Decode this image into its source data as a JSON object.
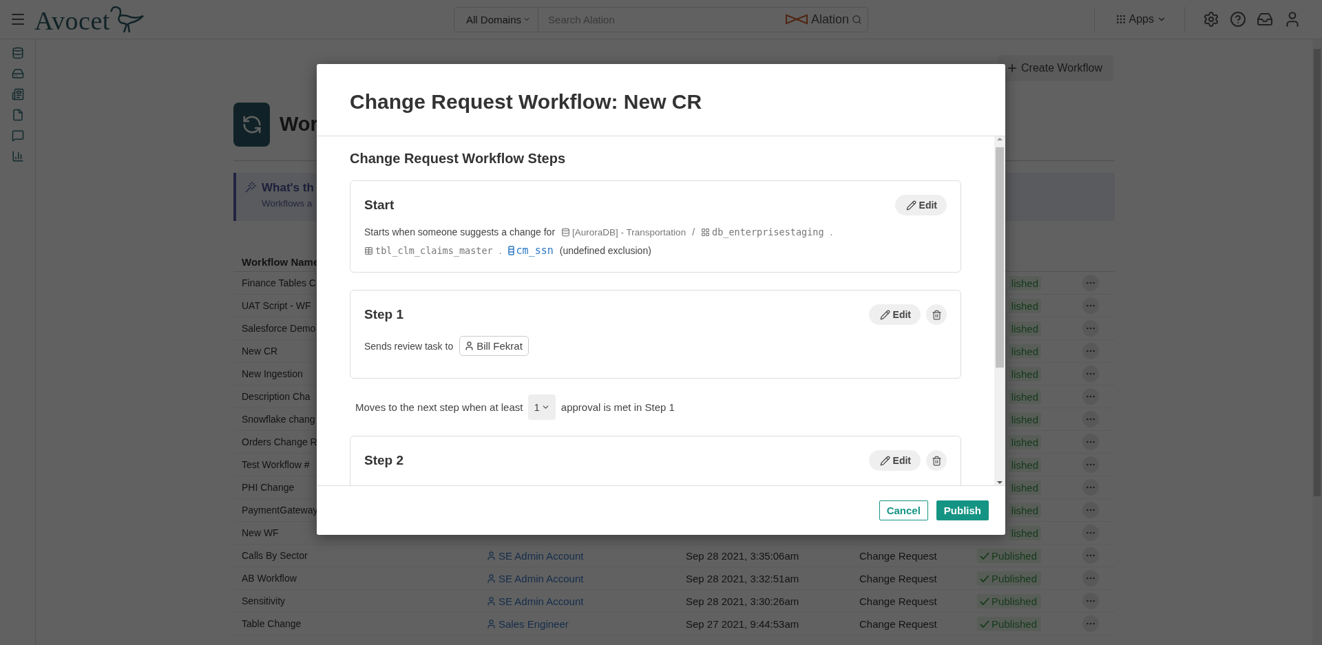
{
  "top_bar": {
    "logo": "Avocet",
    "domain_filter": "All Domains",
    "search": {
      "placeholder": "Search Alation"
    },
    "search_brand": "Alation",
    "apps": "Apps"
  },
  "page": {
    "title": "Wor",
    "create_button": "Create Workflow",
    "banner": {
      "title": "What's th",
      "text": "Workflows a"
    }
  },
  "table": {
    "columns": [
      "Workflow Name"
    ],
    "rows": [
      {
        "name": "Finance Tables C",
        "status": "lished",
        "checkmark": false
      },
      {
        "name": "UAT Script - WF",
        "status": "lished",
        "checkmark": false
      },
      {
        "name": "Salesforce Demo",
        "status": "lished",
        "checkmark": false
      },
      {
        "name": "New CR",
        "status": "lished",
        "checkmark": false
      },
      {
        "name": "New Ingestion",
        "status": "lished",
        "checkmark": false
      },
      {
        "name": "Description Cha",
        "status": "lished",
        "checkmark": false
      },
      {
        "name": "Snowflake chang",
        "status": "lished",
        "checkmark": false
      },
      {
        "name": "Orders Change R",
        "status": "lished",
        "checkmark": false
      },
      {
        "name": "Test Workflow #",
        "status": "lished",
        "checkmark": false
      },
      {
        "name": "PHI Change",
        "status": "lished",
        "checkmark": false
      },
      {
        "name": "PaymentGateway",
        "status": "lished",
        "checkmark": false
      },
      {
        "name": "New WF",
        "status": "lished",
        "checkmark": false
      },
      {
        "name": "Calls By Sector",
        "owner": "SE Admin Account",
        "date": "Sep 28 2021, 3:35:06am",
        "type": "Change Request",
        "status": "Published",
        "checkmark": true
      },
      {
        "name": "AB Workflow",
        "owner": "SE Admin Account",
        "date": "Sep 28 2021, 3:32:51am",
        "type": "Change Request",
        "status": "Published",
        "checkmark": true
      },
      {
        "name": "Sensitivity",
        "owner": "SE Admin Account",
        "date": "Sep 28 2021, 3:30:26am",
        "type": "Change Request",
        "status": "Published",
        "checkmark": true
      },
      {
        "name": "Table Change",
        "owner": "Sales Engineer",
        "date": "Sep 27 2021, 9:44:53am",
        "type": "Change Request",
        "status": "Published",
        "checkmark": true
      }
    ]
  },
  "modal": {
    "title": "Change Request Workflow: New CR",
    "section_title": "Change Request Workflow Steps",
    "steps": [
      {
        "kind": "start",
        "title": "Start",
        "edit": "Edit",
        "text": "Starts when someone suggests a change for",
        "path": [
          {
            "kind": "datasource",
            "label": "[AuroraDB] - Transportation",
            "separator": "/"
          },
          {
            "kind": "schema",
            "label": "db_enterprisestaging",
            "separator": "."
          },
          {
            "kind": "table",
            "label": "tbl_clm_claims_master",
            "separator": "."
          },
          {
            "kind": "column",
            "label": "cm_ssn"
          }
        ],
        "suffix": "(undefined exclusion)"
      },
      {
        "kind": "review",
        "title": "Step 1",
        "edit": "Edit",
        "text": "Sends review task to",
        "assignee": "Bill Fekrat",
        "advance": {
          "before": "Moves to the next step when at least",
          "value": "1",
          "after": "approval is met in Step 1"
        }
      },
      {
        "kind": "review",
        "title": "Step 2",
        "edit": "Edit"
      }
    ],
    "buttons": [
      {
        "label": "Cancel",
        "kind": "secondary"
      },
      {
        "label": "Publish",
        "kind": "primary"
      }
    ]
  }
}
